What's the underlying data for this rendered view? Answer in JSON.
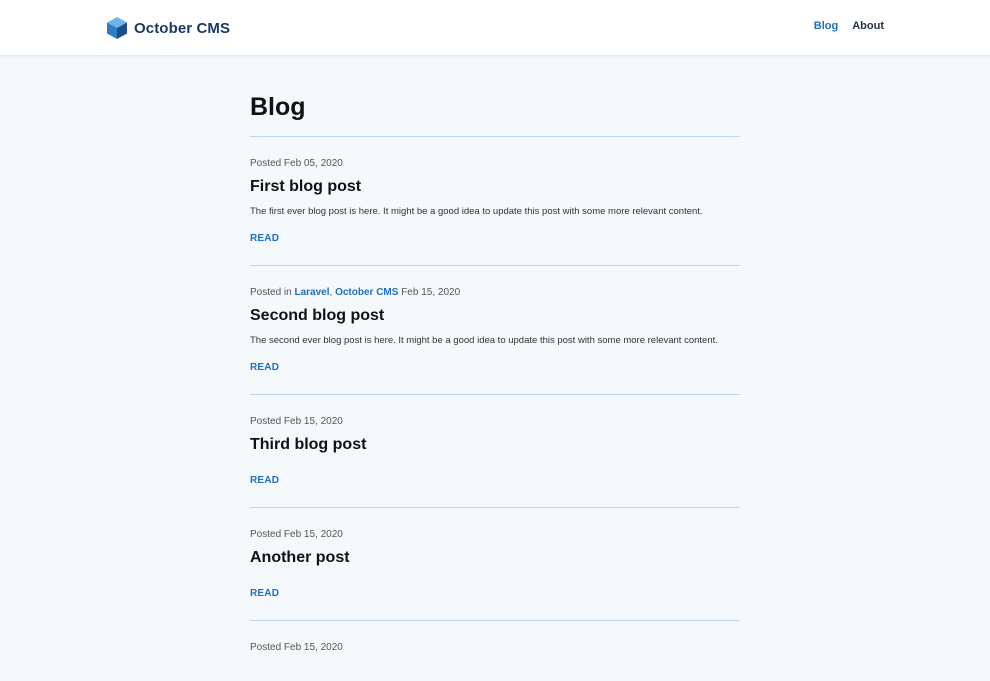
{
  "header": {
    "brand": "October CMS",
    "brand_icon": "cube-logo-icon",
    "nav": [
      {
        "label": "Blog",
        "active": true
      },
      {
        "label": "About",
        "active": false
      }
    ]
  },
  "colors": {
    "accent": "#1f6fba",
    "background": "#f5f9fc",
    "divider": "#bcd8ec"
  },
  "page": {
    "title": "Blog"
  },
  "posts": [
    {
      "meta_prefix": "Posted",
      "date": "Feb 05, 2020",
      "title": "First blog post",
      "excerpt": "The first ever blog post is here. It might be a good idea to update this post with some more relevant content.",
      "read_label": "READ"
    },
    {
      "meta_prefix": "Posted in",
      "categories": [
        "Laravel",
        "October CMS"
      ],
      "date": "Feb 15, 2020",
      "title": "Second blog post",
      "excerpt": "The second ever blog post is here. It might be a good idea to update this post with some more relevant content.",
      "read_label": "READ"
    },
    {
      "meta_prefix": "Posted",
      "date": "Feb 15, 2020",
      "title": "Third blog post",
      "read_label": "READ"
    },
    {
      "meta_prefix": "Posted",
      "date": "Feb 15, 2020",
      "title": "Another post",
      "read_label": "READ"
    },
    {
      "meta_prefix": "Posted",
      "date": "Feb 15, 2020"
    }
  ]
}
